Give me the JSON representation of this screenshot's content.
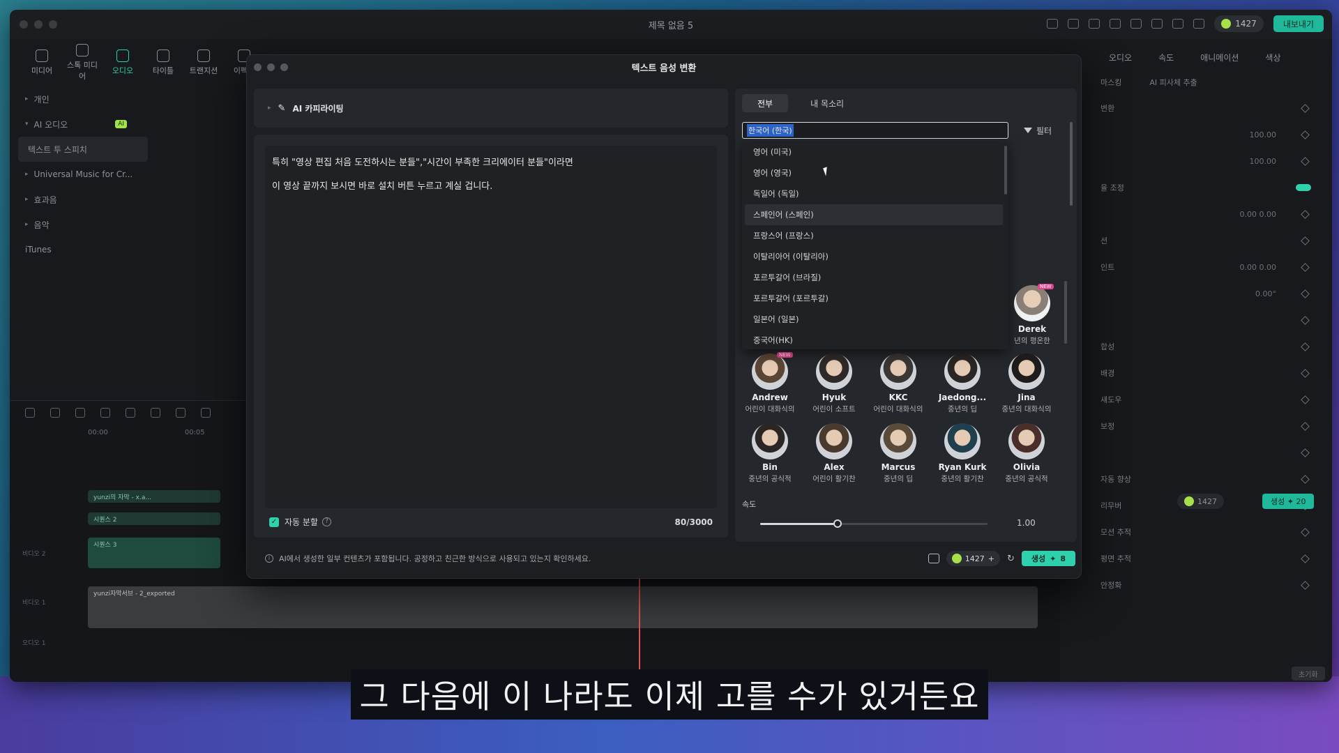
{
  "app": {
    "doc_title": "제목 없음 5",
    "credits": "1427",
    "export_label": "내보내기"
  },
  "toolbar": [
    {
      "label": "미디어"
    },
    {
      "label": "스톡 미디어"
    },
    {
      "label": "오디오"
    },
    {
      "label": "타이틀"
    },
    {
      "label": "트랜지션"
    },
    {
      "label": "이펙트"
    }
  ],
  "sidebar": [
    {
      "label": "개인"
    },
    {
      "label": "AI 오디오",
      "badge": "AI"
    },
    {
      "label": "텍스트 투 스피치"
    },
    {
      "label": "Universal Music for Cr..."
    },
    {
      "label": "효과음"
    },
    {
      "label": "음악"
    },
    {
      "label": "iTunes"
    }
  ],
  "inspector": {
    "tabs": [
      "오디오",
      "속도",
      "애니메이션",
      "색상"
    ],
    "subtabs": [
      "마스킹",
      "AI 피사체 추출"
    ],
    "rows": [
      {
        "label": "변환",
        "val": ""
      },
      {
        "label": "",
        "val": "100.00"
      },
      {
        "label": "",
        "val": "100.00"
      },
      {
        "label": "율 조정",
        "val": ""
      },
      {
        "label": "",
        "val": "0.00    0.00"
      },
      {
        "label": "션",
        "val": ""
      },
      {
        "label": "인트",
        "val": "0.00    0.00"
      },
      {
        "label": "",
        "val": "0.00°"
      },
      {
        "label": "",
        "val": ""
      },
      {
        "label": "합성",
        "val": ""
      },
      {
        "label": "배경",
        "val": ""
      },
      {
        "label": "섀도우",
        "val": ""
      },
      {
        "label": "보정",
        "val": ""
      },
      {
        "label": "",
        "val": ""
      },
      {
        "label": "자동 향상",
        "val": ""
      },
      {
        "label": "리무버",
        "val": ""
      },
      {
        "label": "모션 추적",
        "val": ""
      },
      {
        "label": "평면 추적",
        "val": ""
      },
      {
        "label": "안정화",
        "val": ""
      }
    ],
    "credits": "1427",
    "generate_label": "생성 ✦ 20",
    "reset_label": "초기화"
  },
  "timeline": {
    "times": [
      "00:00",
      "00:05"
    ],
    "tracks": [
      {
        "name": "yunzi의 자막 - x.a..."
      },
      {
        "name": "시퀀스 2"
      },
      {
        "name": "시퀀스 3"
      },
      {
        "name": "yunzi자막서브 - 2_exported"
      }
    ],
    "labels": [
      "비디오 2",
      "비디오 1",
      "오디오 1"
    ]
  },
  "dialog": {
    "title": "텍스트 음성 변환",
    "ai_copywriting": "AI 카피라이팅",
    "text_lines": [
      "특히 \"영상 편집 처음 도전하시는 분들\",\"시간이 부족한 크리에이터 분들\"이라면",
      "이 영상 끝까지 보시면 바로 설치 버튼 누르고 계실 겁니다."
    ],
    "auto_split": "자동 분할",
    "char_count": "80/3000",
    "tabs": [
      "전부",
      "내 목소리"
    ],
    "language_selected": "한국어 (한국)",
    "filter_label": "필터",
    "languages": [
      "영어 (미국)",
      "영어 (영국)",
      "독일어 (독일)",
      "스페인어 (스페인)",
      "프랑스어 (프랑스)",
      "이탈리아어 (이탈리아)",
      "포르투갈어 (브라질)",
      "포르투갈어 (포르투갈)",
      "일본어 (일본)",
      "중국어(HK)"
    ],
    "hovered_index": 3,
    "derek": {
      "name": "Derek",
      "desc": "년의 평온한",
      "new": "NEW"
    },
    "voices_row1": [
      {
        "name": "Andrew",
        "desc": "어린이 대화식의",
        "new": "NEW"
      },
      {
        "name": "Hyuk",
        "desc": "어린이 소프트",
        "new": ""
      },
      {
        "name": "KKC",
        "desc": "어린이 대화식의",
        "new": ""
      },
      {
        "name": "Jaedong...",
        "desc": "중년의 딥",
        "new": ""
      },
      {
        "name": "Jina",
        "desc": "중년의 대화식의",
        "new": ""
      }
    ],
    "voices_row2": [
      {
        "name": "Bin",
        "desc": "중년의 공식적",
        "new": ""
      },
      {
        "name": "Alex",
        "desc": "어린이 활기찬",
        "new": ""
      },
      {
        "name": "Marcus",
        "desc": "중년의 딥",
        "new": ""
      },
      {
        "name": "Ryan Kurk",
        "desc": "중년의 활기찬",
        "new": ""
      },
      {
        "name": "Olivia",
        "desc": "중년의 공식적",
        "new": ""
      }
    ],
    "speed_label": "속도",
    "speed_value": "1.00",
    "speed_fraction": 0.34,
    "disclaimer": "AI에서 생성한 일부 컨텐츠가 포함됩니다. 공정하고 친근한 방식으로 사용되고 있는지 확인하세요.",
    "credits": "1427",
    "generate_label": "생성",
    "generate_cost": "8"
  },
  "subtitle": "그 다음에 이 나라도 이제 고를 수가 있거든요",
  "colors": {
    "accent": "#2fd1ac",
    "selection": "#2e63c7",
    "new_badge": "#e9408e"
  }
}
